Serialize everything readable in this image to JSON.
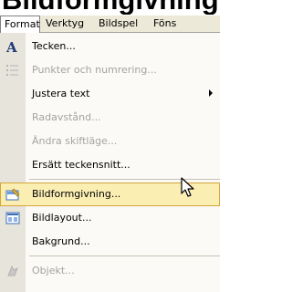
{
  "page_title": "Bildformgivning",
  "menubar": {
    "items": [
      "Format",
      "Verktyg",
      "Bildspel",
      "Föns"
    ]
  },
  "menu": {
    "items": [
      {
        "label": "Tecken...",
        "disabled": false,
        "icon": "font-icon"
      },
      {
        "label": "Punkter och numrering...",
        "disabled": true,
        "icon": "bullets-icon"
      },
      {
        "label": "Justera text",
        "disabled": false,
        "submenu": true
      },
      {
        "label": "Radavstånd...",
        "disabled": true
      },
      {
        "label": "Ändra skiftläge...",
        "disabled": true
      },
      {
        "label": "Ersätt teckensnitt...",
        "disabled": false
      },
      {
        "label": "Bildformgivning...",
        "disabled": false,
        "highlighted": true,
        "icon": "slide-design-icon"
      },
      {
        "label": "Bildlayout...",
        "disabled": false,
        "icon": "slide-layout-icon"
      },
      {
        "label": "Bakgrund...",
        "disabled": false
      },
      {
        "label": "Objekt...",
        "disabled": true,
        "icon": "object-icon"
      }
    ]
  },
  "colors": {
    "menu_background": "#fbfaf6",
    "icon_column": "#e6e4db",
    "highlight_fill": "#fbeeb3",
    "highlight_border": "#d3a43a",
    "disabled_text": "#a3a3a3"
  }
}
